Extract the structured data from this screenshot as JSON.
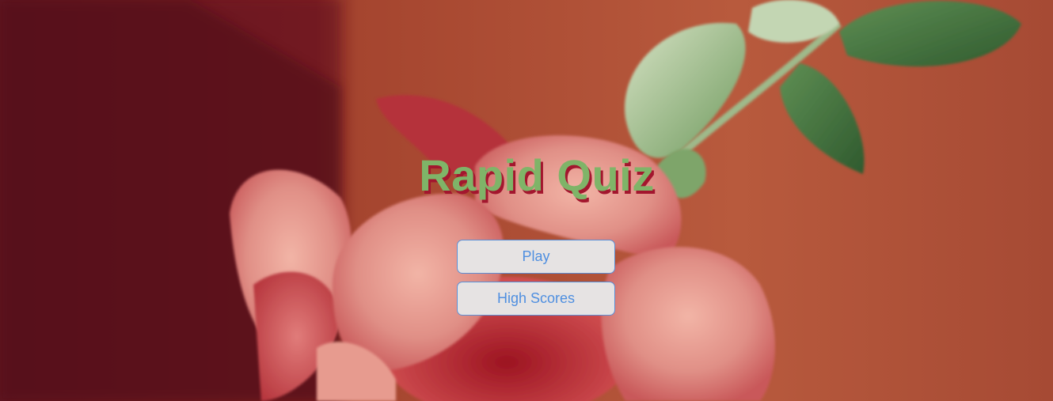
{
  "app": {
    "title": "Rapid Quiz"
  },
  "menu": {
    "play_label": "Play",
    "high_scores_label": "High Scores"
  },
  "colors": {
    "title_text": "#7fb468",
    "title_shadow": "#a3162e",
    "button_bg": "#e6e3e3",
    "button_text": "#4f8fe0",
    "button_border": "#5b8fd6",
    "backdrop": "#b4543a"
  }
}
